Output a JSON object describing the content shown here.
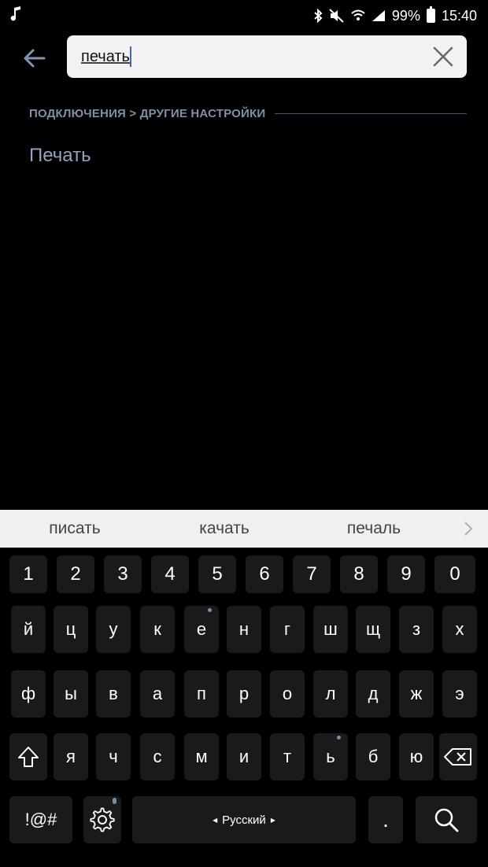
{
  "status_bar": {
    "music_icon": "music-note-icon",
    "battery_percent": "99%",
    "time": "15:40"
  },
  "search": {
    "query": "печать"
  },
  "results": {
    "breadcrumb": "ПОДКЛЮЧЕНИЯ > ДРУГИЕ НАСТРОЙКИ",
    "item": "Печать"
  },
  "suggestions": [
    "писать",
    "качать",
    "печаль"
  ],
  "keyboard": {
    "numbers": [
      "1",
      "2",
      "3",
      "4",
      "5",
      "6",
      "7",
      "8",
      "9",
      "0"
    ],
    "row1": [
      "й",
      "ц",
      "у",
      "к",
      "е",
      "н",
      "г",
      "ш",
      "щ",
      "з",
      "х"
    ],
    "row2": [
      "ф",
      "ы",
      "в",
      "а",
      "п",
      "р",
      "о",
      "л",
      "д",
      "ж",
      "э"
    ],
    "row3": [
      "я",
      "ч",
      "с",
      "м",
      "и",
      "т",
      "ь",
      "б",
      "ю"
    ],
    "symbols_label": "!@#",
    "space_label": "Русский",
    "period_label": ".",
    "colors": {
      "key_bg": "#1a1a1a",
      "key_text": "#ffffff"
    }
  },
  "colors": {
    "accent": "#8ea5c2",
    "breadcrumb": "#7f8fa6",
    "background": "#000000"
  }
}
